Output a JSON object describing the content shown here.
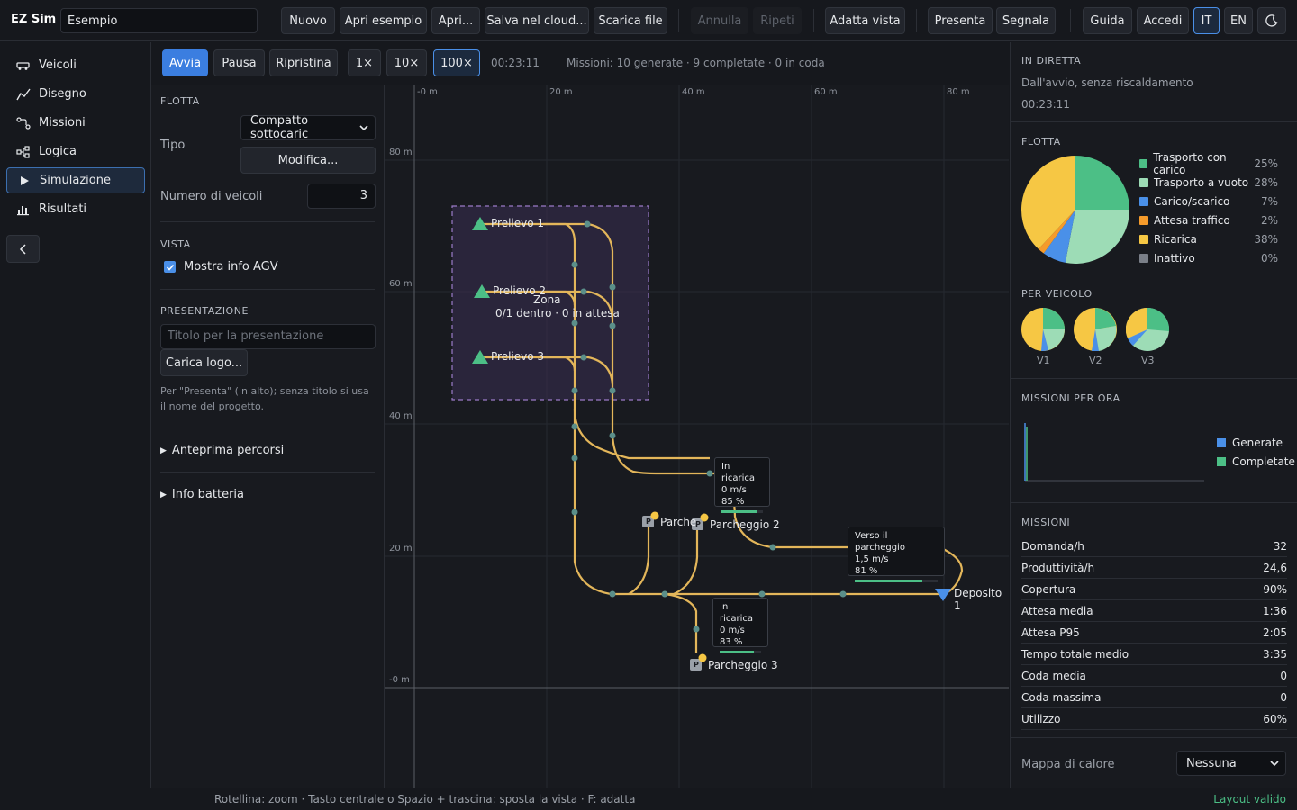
{
  "app": {
    "brand": "EZ Sim",
    "project_name": "Esempio"
  },
  "toolbar": {
    "new": "Nuovo",
    "open_example": "Apri esempio",
    "open": "Apri...",
    "save_cloud": "Salva nel cloud...",
    "download": "Scarica file",
    "undo": "Annulla",
    "redo": "Ripeti",
    "fit_view": "Adatta vista",
    "present": "Presenta",
    "report": "Segnala",
    "guide": "Guida",
    "login": "Accedi",
    "lang_it": "IT",
    "lang_en": "EN"
  },
  "nav": {
    "items": [
      {
        "label": "Veicoli",
        "icon": "vehicle-icon"
      },
      {
        "label": "Disegno",
        "icon": "draw-icon"
      },
      {
        "label": "Missioni",
        "icon": "missions-icon"
      },
      {
        "label": "Logica",
        "icon": "logic-icon"
      },
      {
        "label": "Simulazione",
        "icon": "play-icon"
      },
      {
        "label": "Risultati",
        "icon": "results-icon"
      }
    ]
  },
  "sim": {
    "start": "Avvia",
    "pause": "Pausa",
    "reset": "Ripristina",
    "speed1": "1×",
    "speed10": "10×",
    "speed100": "100×",
    "time": "00:23:11",
    "missions_status": "Missioni: 10 generate · 9 completate · 0 in coda"
  },
  "settings": {
    "fleet_title": "FLOTTA",
    "type_label": "Tipo",
    "type_value": "Compatto sottocaric",
    "edit_btn": "Modifica...",
    "num_vehicles_label": "Numero di veicoli",
    "num_vehicles": "3",
    "view_title": "VISTA",
    "show_agv": "Mostra info AGV",
    "presentation_title": "PRESENTAZIONE",
    "title_placeholder": "Titolo per la presentazione",
    "logo_btn": "Carica logo...",
    "hint": "Per \"Presenta\" (in alto); senza titolo si usa il nome del progetto.",
    "route_preview": "Anteprima percorsi",
    "battery_info": "Info batteria"
  },
  "canvas": {
    "x_ticks": [
      "-0 m",
      "20 m",
      "40 m",
      "60 m",
      "80 m"
    ],
    "y_ticks": [
      "80 m",
      "60 m",
      "40 m",
      "20 m",
      "-0 m"
    ],
    "pickups": [
      "Prelievo 1",
      "Prelievo 2",
      "Prelievo 3"
    ],
    "zone_name": "Zona",
    "zone_status": "0/1 dentro · 0 in attesa",
    "parkings": [
      "Parcheggio 1",
      "Parcheggio 2",
      "Parcheggio 3"
    ],
    "parking_short": "Parche",
    "depot": "Deposito 1",
    "parking_badge": "P",
    "agv_cards": [
      {
        "status": "In ricarica",
        "speed": "0 m/s",
        "battery": "85 %",
        "battery_level": 0.85
      },
      {
        "status": "Verso il parcheggio",
        "speed": "1,5 m/s",
        "battery": "81 %",
        "battery_level": 0.81
      },
      {
        "status": "In ricarica",
        "speed": "0 m/s",
        "battery": "83 %",
        "battery_level": 0.83
      }
    ]
  },
  "right": {
    "live_title": "IN DIRETTA",
    "live_sub": "Dall'avvio, senza riscaldamento",
    "live_time": "00:23:11",
    "fleet_title": "FLOTTA",
    "fleet_legend": [
      {
        "label": "Trasporto con carico",
        "pct": "25%",
        "value": 25,
        "color": "#4cbf86"
      },
      {
        "label": "Trasporto a vuoto",
        "pct": "28%",
        "value": 28,
        "color": "#9ddcb6"
      },
      {
        "label": "Carico/scarico",
        "pct": "7%",
        "value": 7,
        "color": "#4a90e8"
      },
      {
        "label": "Attesa traffico",
        "pct": "2%",
        "value": 2,
        "color": "#f59b2b"
      },
      {
        "label": "Ricarica",
        "pct": "38%",
        "value": 38,
        "color": "#f6c744"
      },
      {
        "label": "Inattivo",
        "pct": "0%",
        "value": 0,
        "color": "#7a7f88"
      }
    ],
    "per_vehicle_title": "PER VEICOLO",
    "vehicles": [
      "V1",
      "V2",
      "V3"
    ],
    "missions_hour_title": "MISSIONI PER ORA",
    "missions_hour_legend": [
      {
        "label": "Generate",
        "color": "#4a90e8"
      },
      {
        "label": "Completate",
        "color": "#4cbf86"
      }
    ],
    "missions_title": "MISSIONI",
    "metrics": [
      {
        "label": "Domanda/h",
        "value": "32"
      },
      {
        "label": "Produttività/h",
        "value": "24,6"
      },
      {
        "label": "Copertura",
        "value": "90%"
      },
      {
        "label": "Attesa media",
        "value": "1:36"
      },
      {
        "label": "Attesa P95",
        "value": "2:05"
      },
      {
        "label": "Tempo totale medio",
        "value": "3:35"
      },
      {
        "label": "Coda media",
        "value": "0"
      },
      {
        "label": "Coda massima",
        "value": "0"
      },
      {
        "label": "Utilizzo",
        "value": "60%"
      }
    ],
    "heatmap_label": "Mappa di calore",
    "heatmap_value": "Nessuna"
  },
  "footer": {
    "hint": "Rotellina: zoom · Tasto centrale o Spazio + trascina: sposta la vista · F: adatta",
    "status": "Layout valido"
  },
  "colors": {
    "accent": "#3b7ee0",
    "route": "#e3b65a",
    "node": "#5b8f8a",
    "valid": "#4cbf86"
  }
}
